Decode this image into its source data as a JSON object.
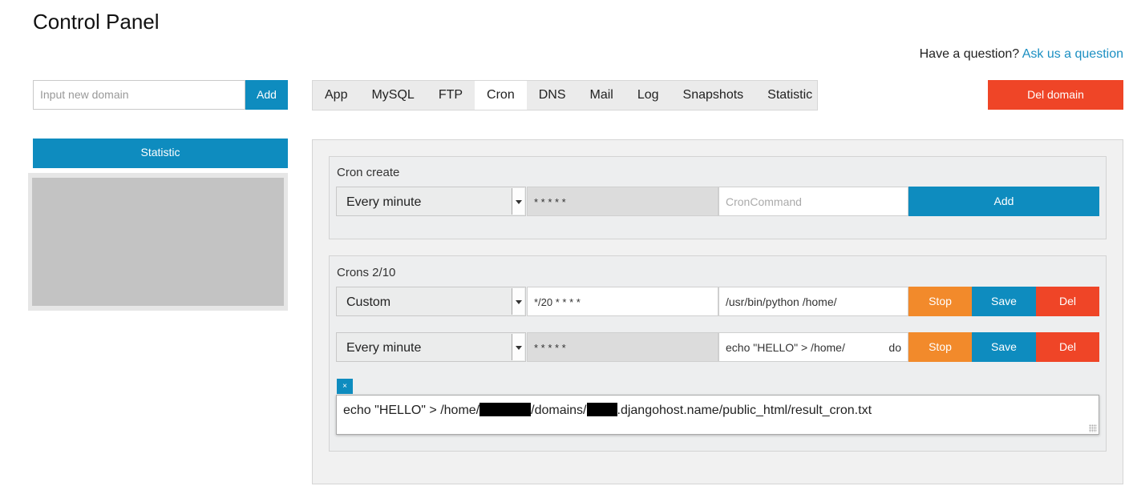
{
  "page": {
    "title": "Control Panel"
  },
  "help": {
    "question": "Have a question?",
    "link": "Ask us a question"
  },
  "domain": {
    "input_placeholder": "Input new domain",
    "add_label": "Add"
  },
  "sidebar": {
    "statistic_label": "Statistic"
  },
  "tabs": [
    {
      "label": "App"
    },
    {
      "label": "MySQL"
    },
    {
      "label": "FTP"
    },
    {
      "label": "Cron",
      "active": true
    },
    {
      "label": "DNS"
    },
    {
      "label": "Mail"
    },
    {
      "label": "Log"
    },
    {
      "label": "Snapshots"
    },
    {
      "label": "Statistic"
    }
  ],
  "del_domain_label": "Del domain",
  "cron_create": {
    "title": "Cron create",
    "schedule": "Every minute",
    "time": "* * * * *",
    "command_placeholder": "CronCommand",
    "add_label": "Add"
  },
  "crons": {
    "title": "Crons 2/10",
    "items": [
      {
        "schedule": "Custom",
        "time": "*/20 * * * *",
        "command": "/usr/bin/python /home/",
        "stop": "Stop",
        "save": "Save",
        "del": "Del"
      },
      {
        "schedule": "Every minute",
        "time": "* * * * *",
        "command": "echo \"HELLO\" > /home/",
        "command_tail": "do",
        "stop": "Stop",
        "save": "Save",
        "del": "Del"
      }
    ],
    "editor": {
      "close": "×",
      "part1": "echo \"HELLO\" > /home/",
      "part2": "/domains/",
      "part3": ".djangohost.name/public_html/result_cron.txt"
    }
  },
  "colors": {
    "blue": "#0e8cbf",
    "red": "#ef4527",
    "orange": "#f28a2b",
    "link": "#1b8fc2"
  }
}
